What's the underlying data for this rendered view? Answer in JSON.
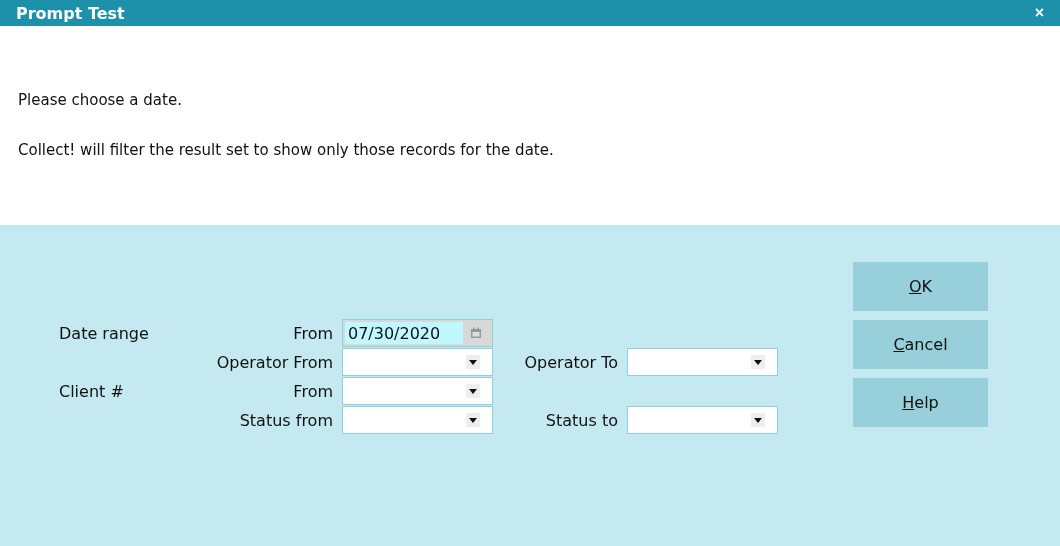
{
  "window": {
    "title": "Prompt Test",
    "close": "×"
  },
  "messages": [
    "Please choose a date.",
    "Collect! will filter the result set to show only those records for the date."
  ],
  "form": {
    "rows": [
      {
        "label": "Date range",
        "fields": [
          {
            "label": "From",
            "kind": "date",
            "value": "07/30/2020"
          }
        ]
      },
      {
        "fields": [
          {
            "label": "Operator From",
            "kind": "dropdown"
          },
          {
            "label": "Operator To",
            "kind": "dropdown"
          }
        ]
      },
      {
        "label": "Client #",
        "fields": [
          {
            "label": "From",
            "kind": "dropdown"
          }
        ]
      },
      {
        "fields": [
          {
            "label": "Status from",
            "kind": "dropdown"
          },
          {
            "label": "Status to",
            "kind": "dropdown"
          }
        ]
      }
    ]
  },
  "buttons": [
    {
      "mnemonic": "O",
      "rest": "K"
    },
    {
      "mnemonic": "C",
      "rest": "ancel"
    },
    {
      "mnemonic": "H",
      "rest": "elp"
    }
  ]
}
